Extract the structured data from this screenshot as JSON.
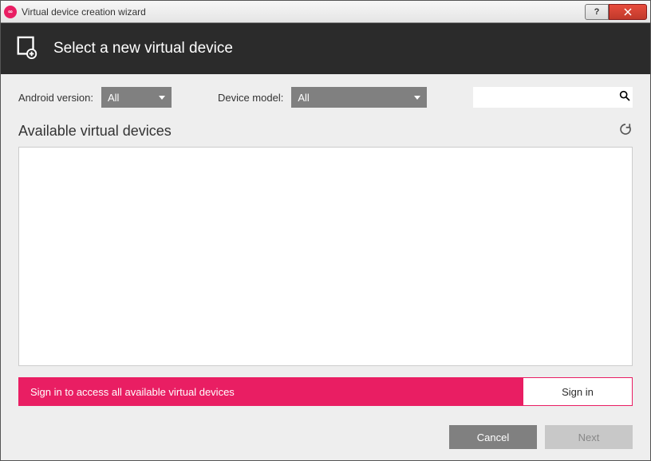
{
  "window": {
    "title": "Virtual device creation wizard"
  },
  "header": {
    "title": "Select a new virtual device"
  },
  "filters": {
    "android_label": "Android version:",
    "android_value": "All",
    "model_label": "Device model:",
    "model_value": "All",
    "search_placeholder": ""
  },
  "list": {
    "title": "Available virtual devices"
  },
  "signin": {
    "message": "Sign in to access all available virtual devices",
    "button": "Sign in"
  },
  "footer": {
    "cancel": "Cancel",
    "next": "Next"
  }
}
